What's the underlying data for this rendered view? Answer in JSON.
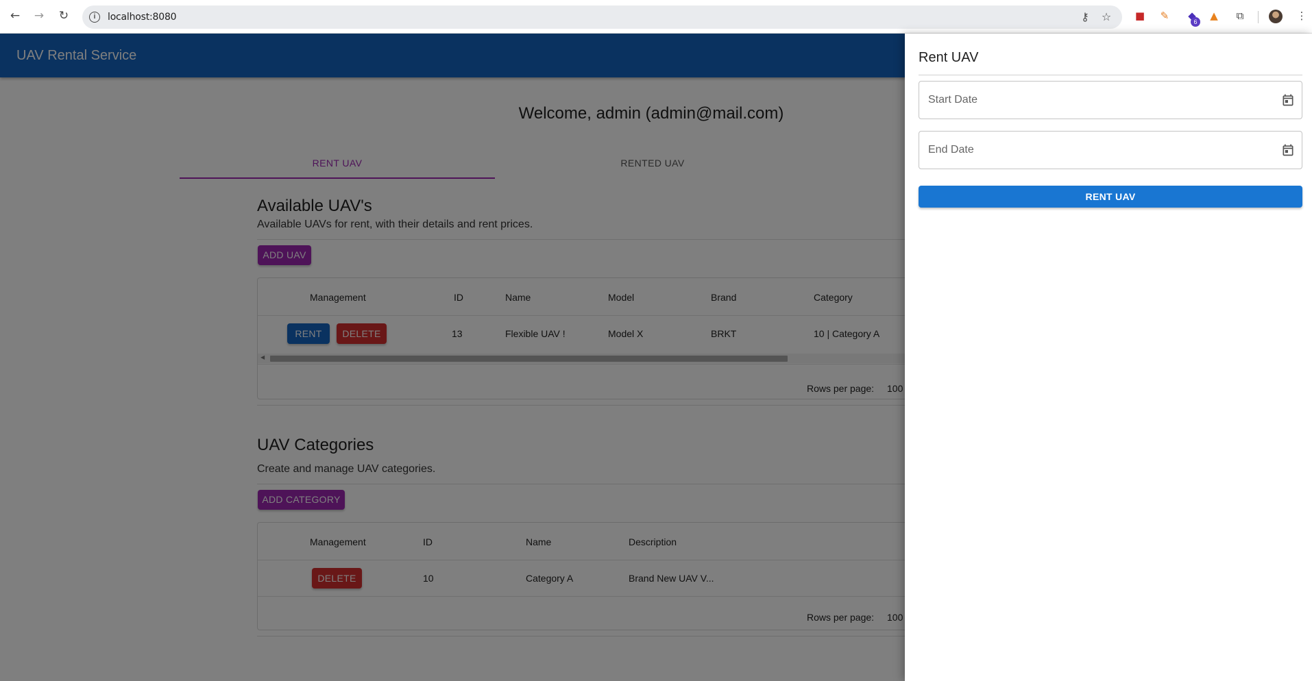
{
  "browser": {
    "url": "localhost:8080",
    "extension_badge": "6"
  },
  "app": {
    "brand": "UAV Rental Service",
    "colors": {
      "primary": "#1565c0",
      "secondary": "#9c27b0",
      "danger": "#d32f2f",
      "action": "#1976d2"
    }
  },
  "welcome": "Welcome, admin (admin@mail.com)",
  "tabs": [
    {
      "label": "RENT UAV",
      "active": true
    },
    {
      "label": "RENTED UAV",
      "active": false
    }
  ],
  "uavs": {
    "title": "Available UAV's",
    "subtitle": "Available UAVs for rent, with their details and rent prices.",
    "add_label": "ADD UAV",
    "columns": [
      "Management",
      "ID",
      "Name",
      "Model",
      "Brand",
      "Category"
    ],
    "rows": [
      {
        "rent_label": "RENT",
        "delete_label": "DELETE",
        "id": "13",
        "name": "Flexible UAV !",
        "model": "Model X",
        "brand": "BRKT",
        "category": "10 | Category A"
      }
    ],
    "rows_per_page_label": "Rows per page:",
    "rows_per_page": "100"
  },
  "categories": {
    "title": "UAV Categories",
    "subtitle": "Create and manage UAV categories.",
    "add_label": "ADD CATEGORY",
    "columns": [
      "Management",
      "ID",
      "Name",
      "Description"
    ],
    "rows": [
      {
        "delete_label": "DELETE",
        "id": "10",
        "name": "Category A",
        "description": "Brand New UAV V..."
      }
    ],
    "rows_per_page_label": "Rows per page:",
    "rows_per_page": "100"
  },
  "drawer": {
    "title": "Rent UAV",
    "start_placeholder": "Start Date",
    "end_placeholder": "End Date",
    "submit_label": "RENT UAV"
  }
}
